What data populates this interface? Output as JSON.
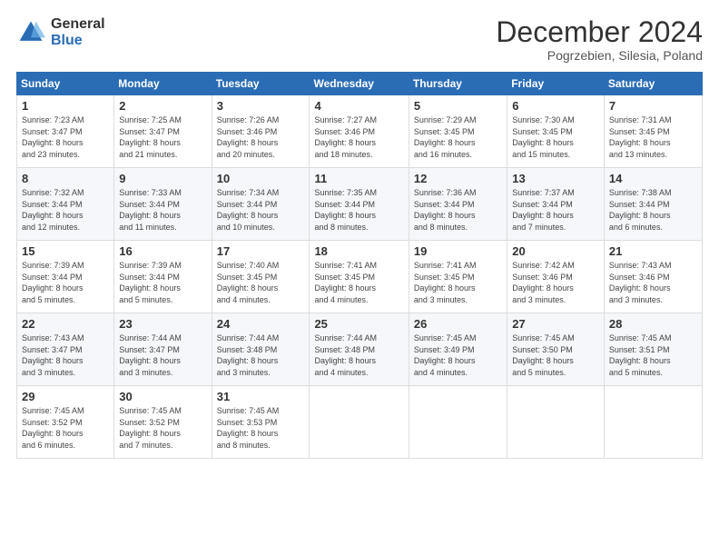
{
  "logo": {
    "general": "General",
    "blue": "Blue"
  },
  "header": {
    "title": "December 2024",
    "location": "Pogrzebien, Silesia, Poland"
  },
  "weekdays": [
    "Sunday",
    "Monday",
    "Tuesday",
    "Wednesday",
    "Thursday",
    "Friday",
    "Saturday"
  ],
  "weeks": [
    [
      {
        "day": "1",
        "sunrise": "7:23 AM",
        "sunset": "3:47 PM",
        "daylight": "8 hours and 23 minutes."
      },
      {
        "day": "2",
        "sunrise": "7:25 AM",
        "sunset": "3:47 PM",
        "daylight": "8 hours and 21 minutes."
      },
      {
        "day": "3",
        "sunrise": "7:26 AM",
        "sunset": "3:46 PM",
        "daylight": "8 hours and 20 minutes."
      },
      {
        "day": "4",
        "sunrise": "7:27 AM",
        "sunset": "3:46 PM",
        "daylight": "8 hours and 18 minutes."
      },
      {
        "day": "5",
        "sunrise": "7:29 AM",
        "sunset": "3:45 PM",
        "daylight": "8 hours and 16 minutes."
      },
      {
        "day": "6",
        "sunrise": "7:30 AM",
        "sunset": "3:45 PM",
        "daylight": "8 hours and 15 minutes."
      },
      {
        "day": "7",
        "sunrise": "7:31 AM",
        "sunset": "3:45 PM",
        "daylight": "8 hours and 13 minutes."
      }
    ],
    [
      {
        "day": "8",
        "sunrise": "7:32 AM",
        "sunset": "3:44 PM",
        "daylight": "8 hours and 12 minutes."
      },
      {
        "day": "9",
        "sunrise": "7:33 AM",
        "sunset": "3:44 PM",
        "daylight": "8 hours and 11 minutes."
      },
      {
        "day": "10",
        "sunrise": "7:34 AM",
        "sunset": "3:44 PM",
        "daylight": "8 hours and 10 minutes."
      },
      {
        "day": "11",
        "sunrise": "7:35 AM",
        "sunset": "3:44 PM",
        "daylight": "8 hours and 8 minutes."
      },
      {
        "day": "12",
        "sunrise": "7:36 AM",
        "sunset": "3:44 PM",
        "daylight": "8 hours and 8 minutes."
      },
      {
        "day": "13",
        "sunrise": "7:37 AM",
        "sunset": "3:44 PM",
        "daylight": "8 hours and 7 minutes."
      },
      {
        "day": "14",
        "sunrise": "7:38 AM",
        "sunset": "3:44 PM",
        "daylight": "8 hours and 6 minutes."
      }
    ],
    [
      {
        "day": "15",
        "sunrise": "7:39 AM",
        "sunset": "3:44 PM",
        "daylight": "8 hours and 5 minutes."
      },
      {
        "day": "16",
        "sunrise": "7:39 AM",
        "sunset": "3:44 PM",
        "daylight": "8 hours and 5 minutes."
      },
      {
        "day": "17",
        "sunrise": "7:40 AM",
        "sunset": "3:45 PM",
        "daylight": "8 hours and 4 minutes."
      },
      {
        "day": "18",
        "sunrise": "7:41 AM",
        "sunset": "3:45 PM",
        "daylight": "8 hours and 4 minutes."
      },
      {
        "day": "19",
        "sunrise": "7:41 AM",
        "sunset": "3:45 PM",
        "daylight": "8 hours and 3 minutes."
      },
      {
        "day": "20",
        "sunrise": "7:42 AM",
        "sunset": "3:46 PM",
        "daylight": "8 hours and 3 minutes."
      },
      {
        "day": "21",
        "sunrise": "7:43 AM",
        "sunset": "3:46 PM",
        "daylight": "8 hours and 3 minutes."
      }
    ],
    [
      {
        "day": "22",
        "sunrise": "7:43 AM",
        "sunset": "3:47 PM",
        "daylight": "8 hours and 3 minutes."
      },
      {
        "day": "23",
        "sunrise": "7:44 AM",
        "sunset": "3:47 PM",
        "daylight": "8 hours and 3 minutes."
      },
      {
        "day": "24",
        "sunrise": "7:44 AM",
        "sunset": "3:48 PM",
        "daylight": "8 hours and 3 minutes."
      },
      {
        "day": "25",
        "sunrise": "7:44 AM",
        "sunset": "3:48 PM",
        "daylight": "8 hours and 4 minutes."
      },
      {
        "day": "26",
        "sunrise": "7:45 AM",
        "sunset": "3:49 PM",
        "daylight": "8 hours and 4 minutes."
      },
      {
        "day": "27",
        "sunrise": "7:45 AM",
        "sunset": "3:50 PM",
        "daylight": "8 hours and 5 minutes."
      },
      {
        "day": "28",
        "sunrise": "7:45 AM",
        "sunset": "3:51 PM",
        "daylight": "8 hours and 5 minutes."
      }
    ],
    [
      {
        "day": "29",
        "sunrise": "7:45 AM",
        "sunset": "3:52 PM",
        "daylight": "8 hours and 6 minutes."
      },
      {
        "day": "30",
        "sunrise": "7:45 AM",
        "sunset": "3:52 PM",
        "daylight": "8 hours and 7 minutes."
      },
      {
        "day": "31",
        "sunrise": "7:45 AM",
        "sunset": "3:53 PM",
        "daylight": "8 hours and 8 minutes."
      },
      null,
      null,
      null,
      null
    ]
  ]
}
